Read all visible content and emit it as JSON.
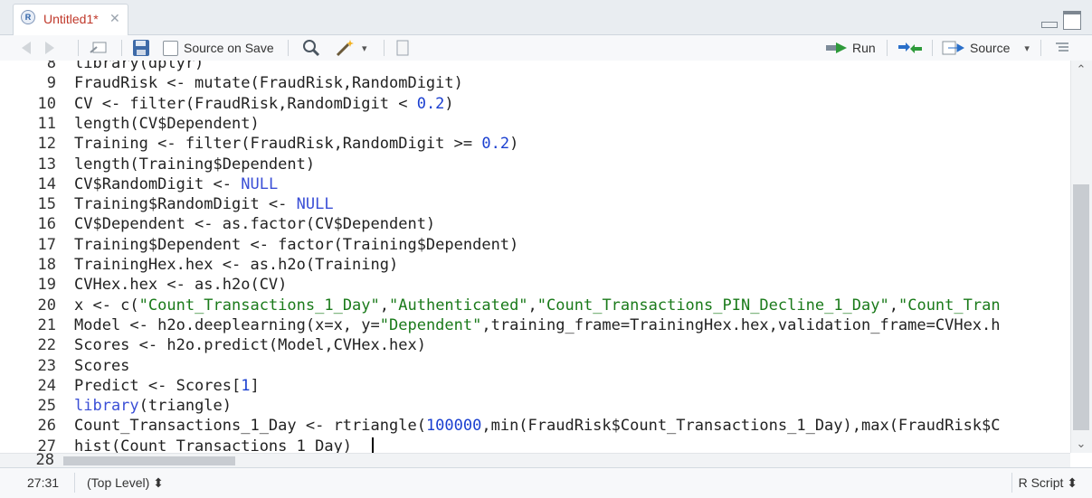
{
  "tab": {
    "title": "Untitled1*",
    "close_glyph": "✕",
    "r_glyph": "R"
  },
  "toolbar": {
    "source_on_save_label": "Source on Save",
    "run_label": "Run",
    "source_label": "Source",
    "source_dropdown_glyph": "▾",
    "tools_dropdown_glyph": "▾"
  },
  "editor": {
    "lines": [
      {
        "num": "8",
        "html": "library(dplyr)"
      },
      {
        "num": "9",
        "html": "FraudRisk <- mutate(FraudRisk,RandomDigit)"
      },
      {
        "num": "10",
        "html": "CV <- filter(FraudRisk,RandomDigit < <span class='num'>0.2</span>)"
      },
      {
        "num": "11",
        "html": "length(CV$Dependent)"
      },
      {
        "num": "12",
        "html": "Training <- filter(FraudRisk,RandomDigit >= <span class='num'>0.2</span>)"
      },
      {
        "num": "13",
        "html": "length(Training$Dependent)"
      },
      {
        "num": "14",
        "html": "CV$RandomDigit <- <span class='kw'>NULL</span>"
      },
      {
        "num": "15",
        "html": "Training$RandomDigit <- <span class='kw'>NULL</span>"
      },
      {
        "num": "16",
        "html": "CV$Dependent <- as.factor(CV$Dependent)"
      },
      {
        "num": "17",
        "html": "Training$Dependent <- factor(Training$Dependent)"
      },
      {
        "num": "18",
        "html": "TrainingHex.hex <- as.h2o(Training)"
      },
      {
        "num": "19",
        "html": "CVHex.hex <- as.h2o(CV)"
      },
      {
        "num": "20",
        "html": "x <- c(<span class='str'>\"Count_Transactions_1_Day\"</span>,<span class='str'>\"Authenticated\"</span>,<span class='str'>\"Count_Transactions_PIN_Decline_1_Day\"</span>,<span class='str'>\"Count_Tran</span>"
      },
      {
        "num": "21",
        "html": "Model <- h2o.deeplearning(x=x, y=<span class='str'>\"Dependent\"</span>,training_frame=TrainingHex.hex,validation_frame=CVHex.h"
      },
      {
        "num": "22",
        "html": "Scores <- h2o.predict(Model,CVHex.hex)"
      },
      {
        "num": "23",
        "html": "Scores"
      },
      {
        "num": "24",
        "html": "Predict <- Scores[<span class='num'>1</span>]"
      },
      {
        "num": "25",
        "html": "<span class='kw'>library</span>(triangle)"
      },
      {
        "num": "26",
        "html": "Count_Transactions_1_Day <- rtriangle(<span class='num'>100000</span>,min(FraudRisk$Count_Transactions_1_Day),max(FraudRisk$C"
      },
      {
        "num": "27",
        "html": "hist(Count_Transactions_1_Day)"
      }
    ],
    "last_line_num": "28"
  },
  "status": {
    "cursor_position": "27:31",
    "scope": "(Top Level) ⬍",
    "file_type": "R Script ⬍"
  },
  "colors": {
    "string": "#1a7a1a",
    "number": "#1a3fd0",
    "keyword": "#3b4fd6",
    "tab_title": "#c0392b"
  },
  "icons": [
    "r-file-icon",
    "close-icon",
    "back-arrow-icon",
    "forward-arrow-icon",
    "show-in-window-icon",
    "save-icon",
    "search-icon",
    "magic-wand-icon",
    "compile-report-icon",
    "run-arrow-icon",
    "rerun-icon",
    "source-icon",
    "outline-icon",
    "minimize-icon",
    "maximize-icon"
  ]
}
